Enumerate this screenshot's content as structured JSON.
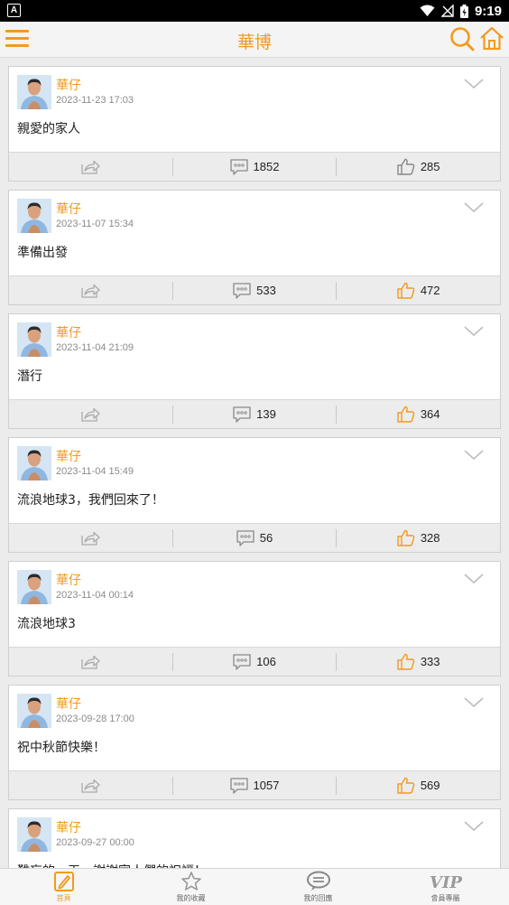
{
  "status_bar": {
    "time": "9:19",
    "left_icon": "A"
  },
  "header": {
    "title": "華博"
  },
  "posts": [
    {
      "user": "華仔",
      "time": "2023-11-23 17:03",
      "text": "親愛的家人",
      "comments": "1852",
      "likes": "285",
      "liked": false
    },
    {
      "user": "華仔",
      "time": "2023-11-07 15:34",
      "text": "準備出發",
      "comments": "533",
      "likes": "472",
      "liked": true
    },
    {
      "user": "華仔",
      "time": "2023-11-04 21:09",
      "text": "潛行",
      "comments": "139",
      "likes": "364",
      "liked": true
    },
    {
      "user": "華仔",
      "time": "2023-11-04 15:49",
      "text": "流浪地球3，我們回來了！",
      "comments": "56",
      "likes": "328",
      "liked": true
    },
    {
      "user": "華仔",
      "time": "2023-11-04 00:14",
      "text": "流浪地球3",
      "comments": "106",
      "likes": "333",
      "liked": true
    },
    {
      "user": "華仔",
      "time": "2023-09-28 17:00",
      "text": "祝中秋節快樂！",
      "comments": "1057",
      "likes": "569",
      "liked": true
    },
    {
      "user": "華仔",
      "time": "2023-09-27 00:00",
      "text": "難忘的一天，謝謝家人們的祝福！",
      "comments": "",
      "likes": "",
      "liked": true
    }
  ],
  "tabs": [
    {
      "label": "首頁",
      "icon": "edit-icon",
      "active": true
    },
    {
      "label": "我的收藏",
      "icon": "star-icon",
      "active": false
    },
    {
      "label": "我的回應",
      "icon": "chat-icon",
      "active": false
    },
    {
      "label": "會員專屬",
      "icon": "vip-icon",
      "active": false
    }
  ],
  "colors": {
    "accent": "#f29a1f",
    "inactive_icon": "#b8b8b8",
    "background": "#ececec"
  }
}
